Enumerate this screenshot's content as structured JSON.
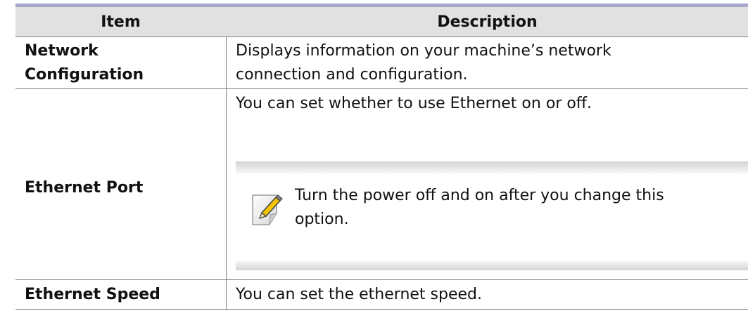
{
  "table": {
    "headers": {
      "item": "Item",
      "description": "Description"
    },
    "rows": [
      {
        "item_lines": [
          "Network",
          "Configuration"
        ],
        "description_lines": [
          "Displays information on your machine’s network",
          "connection and configuration."
        ]
      },
      {
        "item": "Ethernet Port",
        "description": "You can set whether to use Ethernet on or off.",
        "note": {
          "icon": "note-pencil-icon",
          "lines": [
            "Turn the power off and on after you change this",
            "option."
          ]
        }
      },
      {
        "item": "Ethernet Speed",
        "description": "You can set the ethernet speed."
      }
    ]
  },
  "colors": {
    "header_rule": "#a6a8d0",
    "header_background": "#e1e1e1",
    "grid_line": "#7e7e7e",
    "note_band": "#dcdcdc",
    "icon_accent": "#f2c400"
  }
}
